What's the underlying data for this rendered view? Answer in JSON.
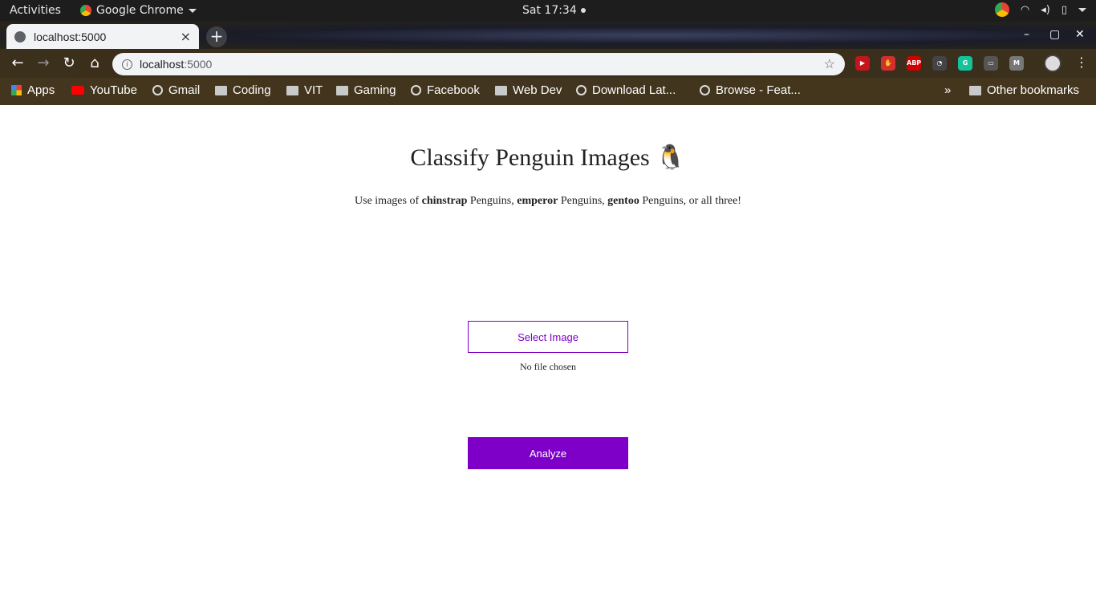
{
  "os_bar": {
    "activities": "Activities",
    "app_name": "Google Chrome",
    "clock": "Sat 17:34"
  },
  "tab": {
    "title": "localhost:5000",
    "close": "×"
  },
  "new_tab": "+",
  "window_controls": {
    "minimize": "–",
    "maximize": "▢",
    "close": "✕"
  },
  "nav": {
    "back": "←",
    "forward": "→",
    "reload": "↻",
    "home": "⌂"
  },
  "omnibox": {
    "info": "i",
    "host": "localhost",
    "port": ":5000",
    "star": "☆"
  },
  "extensions": [
    {
      "name": "extension-1-icon",
      "color": "#c4151c",
      "text": "▶"
    },
    {
      "name": "extension-2-icon",
      "color": "#d32f2f",
      "text": "✋"
    },
    {
      "name": "adblock-plus-icon",
      "color": "#d10000",
      "text": "ABP"
    },
    {
      "name": "speed-dial-icon",
      "color": "#444444",
      "text": "◔"
    },
    {
      "name": "grammarly-icon",
      "color": "#15c39a",
      "text": "G"
    },
    {
      "name": "cast-icon",
      "color": "#555555",
      "text": "▭"
    },
    {
      "name": "extension-m-icon",
      "color": "#777777",
      "text": "M"
    }
  ],
  "bookmarks": {
    "items": [
      {
        "label": "Apps",
        "icon": "apps-grid-icon"
      },
      {
        "label": "YouTube",
        "icon": "youtube-icon"
      },
      {
        "label": "Gmail",
        "icon": "globe-icon"
      },
      {
        "label": "Coding",
        "icon": "folder-icon"
      },
      {
        "label": "VIT",
        "icon": "folder-icon"
      },
      {
        "label": "Gaming",
        "icon": "folder-icon"
      },
      {
        "label": "Facebook",
        "icon": "globe-icon"
      },
      {
        "label": "Web Dev",
        "icon": "folder-icon"
      },
      {
        "label": "Download Lat...",
        "icon": "globe-icon"
      },
      {
        "label": "Browse - Feat...",
        "icon": "globe-icon"
      }
    ],
    "overflow": "»",
    "other": "Other bookmarks"
  },
  "page": {
    "title": "Classify Penguin Images",
    "title_emoji": "🐧",
    "intro_parts": {
      "p1": "Use images of ",
      "b1": "chinstrap",
      "p2": " Penguins, ",
      "b2": "emperor",
      "p3": " Penguins, ",
      "b3": "gentoo",
      "p4": " Penguins, or all three!"
    },
    "select_button": "Select Image",
    "file_status": "No file chosen",
    "analyze_button": "Analyze"
  },
  "colors": {
    "accent": "#7e00c8"
  }
}
